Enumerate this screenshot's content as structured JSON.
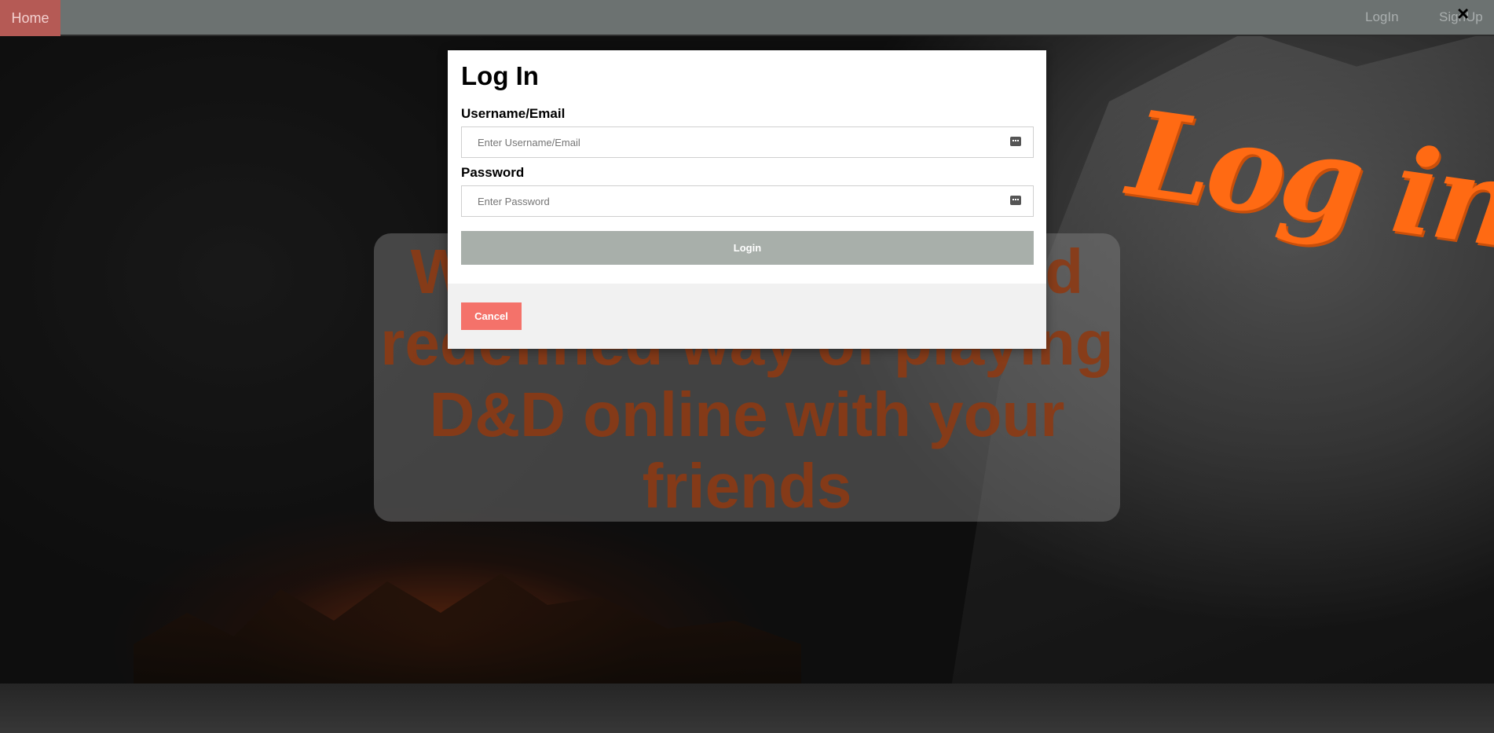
{
  "nav": {
    "home": "Home",
    "login": "LogIn",
    "signup": "SignUp",
    "close": "×"
  },
  "hero": {
    "text": "Welcome to a new and redefined way of playing D&D online with your friends",
    "title_art": "Log in"
  },
  "modal": {
    "title": "Log In",
    "username_label": "Username/Email",
    "username_placeholder": "Enter Username/Email",
    "username_value": "",
    "password_label": "Password",
    "password_placeholder": "Enter Password",
    "password_value": "",
    "login_button": "Login",
    "cancel_button": "Cancel"
  },
  "colors": {
    "accent": "#ff6a13",
    "home_tab": "#b55a55",
    "cancel": "#f4726a",
    "login_button": "#a8afaa",
    "navbar": "#6c7271"
  },
  "icons": {
    "field_icon": "password-manager-key-icon",
    "close": "close-icon"
  }
}
